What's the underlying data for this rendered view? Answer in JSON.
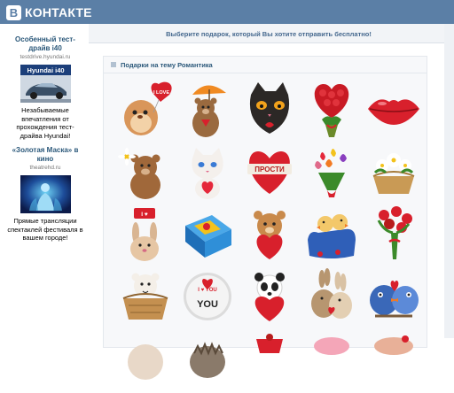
{
  "header": {
    "logo_letter": "В",
    "logo_text": "КОНТАКТЕ"
  },
  "sidebar": {
    "ads": [
      {
        "title": "Особенный тест-драйв i40",
        "domain": "testdrive.hyundai.ru",
        "image_label": "Hyundai i40",
        "text": "Незабываемые впечатления от прохождения тест-драйва Hyundai!"
      },
      {
        "title": "«Золотая Маска» в кино",
        "domain": "theatrehd.ru",
        "text": "Прямые трансляции спектаклей фестиваля в вашем городе!"
      }
    ]
  },
  "main": {
    "top_message": "Выберите подарок, который Вы хотите отправить бесплатно!",
    "section_title": "Подарки на тему Романтика",
    "gift_texts": {
      "love_balloon": "I LOVE",
      "prosti": "ПРОСТИ",
      "i_love": "I ♥",
      "love_you": "I ♥ YOU",
      "you": "YOU"
    }
  },
  "colors": {
    "header": "#5b7fa6",
    "link": "#2b587a",
    "panel": "#f7f8fa"
  }
}
